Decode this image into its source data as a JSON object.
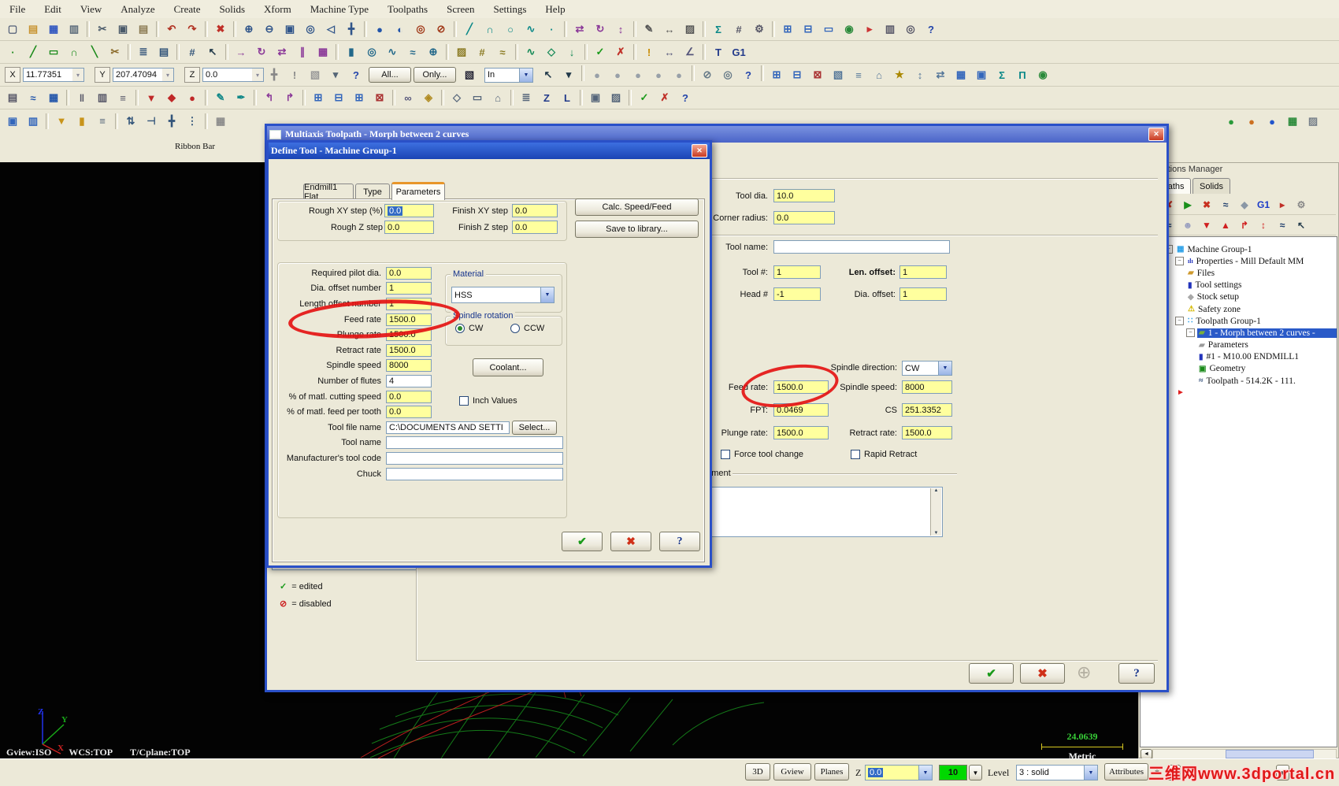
{
  "menu": {
    "items": [
      "File",
      "Edit",
      "View",
      "Analyze",
      "Create",
      "Solids",
      "Xform",
      "Machine Type",
      "Toolpaths",
      "Screen",
      "Settings",
      "Help"
    ]
  },
  "coord_bar": {
    "x": {
      "label": "X",
      "value": "11.77351"
    },
    "y": {
      "label": "Y",
      "value": "207.47094"
    },
    "z": {
      "label": "Z",
      "value": "0.0"
    },
    "all": "All...",
    "only": "Only...",
    "in": "In"
  },
  "ribbon_bar": "Ribbon Bar",
  "icons": {
    "ok": "✔",
    "cancel": "✖",
    "help": "?",
    "plus": "⊕",
    "close": "✕",
    "legend_check": "✓",
    "legend_disabled": "⊘",
    "up": "▲",
    "down": "▼",
    "left": "◄",
    "combo": "▼",
    "drop": "▾"
  },
  "toolbars": {
    "row1": [
      "new|▢|#55617a",
      "open|▤|#c89432",
      "save|▦|#2f55c0",
      "print|▥|#5a6a7a",
      "-",
      "cut|✂|#4a5a6a",
      "copy|▣|#4a5a6a",
      "paste|▤|#8a7a52",
      "-",
      "undo|↶|#b03020",
      "redo|↷|#b03020",
      "-",
      "delete|✖|#c03028",
      "-",
      "zoom-in|⊕|#30558a",
      "zoom-out|⊖|#30558a",
      "zoom-window|▣|#30558a",
      "zoom-fit|◎|#30558a",
      "zoom-previous|◁|#30558a",
      "pan|╋|#30558a",
      "-",
      "shade-sphere|●|#2255aa",
      "shade-half|◐|#2255aa",
      "wireframe-torus|◎|#a03818",
      "wireframe-off|⊘|#a03818",
      "-",
      "line|╱|#0a8888",
      "arc|∩|#0a8888",
      "circle|○|#0a8888",
      "spline|∿|#0a8888",
      "point|∙|#0a8888",
      "-",
      "mirror|⇄|#8a3898",
      "rotate|↻|#8a3898",
      "scale|↕|#8a3898",
      "-",
      "note|✎|#555555",
      "dimension|↔|#555555",
      "hatch|▨|#555555",
      "-",
      "sum|Σ|#0a8888",
      "grid|#|#555566",
      "gear|⚙|#555566",
      "-",
      "window-tile|⊞|#3366bb",
      "window-cascade|⊟|#3366bb",
      "screen|▭|#3366bb",
      "world|◉|#2a8a3a",
      "flag|▸|#cc3333",
      "film|▥|#555566",
      "camera|◎|#555566",
      "help|?|#2244aa"
    ],
    "row2": [
      "create-point|∙|#1a8a1a",
      "create-line|╱|#1a8a1a",
      "create-rect|▭|#1a8a1a",
      "create-fillet|∩|#1a8a1a",
      "create-chamfer|╲|#1a8a1a",
      "trim|✂|#8a6a2a",
      "-",
      "levels|≣|#33557a",
      "layers|▤|#33557a",
      "-",
      "snap|#|#33557a",
      "cursor|↖|#223a4a",
      "-",
      "xform-translate|→|#8a3898",
      "xform-rotate|↻|#8a3898",
      "xform-mirror|⇄|#8a3898",
      "xform-offset|∥|#8a3898",
      "xform-array|▦|#8a3898",
      "-",
      "extrude|▮|#22688a",
      "revolve|◎|#22688a",
      "sweep|∿|#22688a",
      "loft|≈|#22688a",
      "boolean|⊕|#22688a",
      "-",
      "surface|▨|#8a7a22",
      "net|#|#8a7a22",
      "blend|≈|#8a7a22",
      "-",
      "curve|∿|#118855",
      "isoparm|◇|#118855",
      "project|↓|#118855",
      "-",
      "ok-check|✓|#1a9a1a",
      "cancel-x|✗|#c03028",
      "-",
      "info|!|#c88a00",
      "measure|↔|#55557a",
      "angle|∠|#55557a",
      "-",
      "tool-letter|T|#223a8a",
      "post-g1|G1|#223a8a"
    ],
    "row3_pre": [
      "attach|╋|#888888",
      "alert|!|#888888",
      "fan|▧|#999999",
      "drop|▾|#556677",
      "help-round|?|#2244aa"
    ],
    "row3_post": [
      "pointer|↖|#223a4a",
      "pointer-drop|▾|#223a4a",
      "-",
      "chain-1|●|#98a0a8",
      "chain-2|●|#98a0a8",
      "chain-3|●|#98a0a8",
      "chain-4|●|#98a0a8",
      "chain-5|●|#98a0a8",
      "-",
      "none|⊘|#667a88",
      "target|◎|#667a88",
      "help-2|?|#2244aa",
      "-",
      "win-1|⊞|#3366bb",
      "win-2|⊟|#3366bb",
      "win-3|⊠|#aa3333",
      "panel|▧|#557799",
      "list|≡|#557799",
      "home|⌂|#557799",
      "star|★|#aa8800",
      "vflip|↕|#557799",
      "swap|⇄|#557799",
      "grid-2|▦|#3366bb",
      "box-2|▣|#3366bb",
      "sigma|Σ|#0a8888",
      "pi|Π|#0a8888",
      "globe|◉|#2a8a3a"
    ],
    "row4": [
      "levels-2|▤|#555566",
      "waves|≈|#2255aa",
      "grid-3|▦|#2255aa",
      "-",
      "bars|‖|#555566",
      "cells|▥|#555566",
      "rows|≡|#555566",
      "-",
      "red-down|▼|#c02828",
      "red-diamond|◆|#c02828",
      "red-dot|●|#c02828",
      "-",
      "pencil|✎|#118888",
      "pen|✒|#118888",
      "-",
      "turn-left|↰|#8a3898",
      "turn-right|↱|#8a3898",
      "-",
      "win-a|⊞|#3366bb",
      "win-b|⊟|#3366bb",
      "win-c|⊞|#3366bb",
      "win-d|⊠|#aa3333",
      "-",
      "chain|∞|#55557a",
      "lock|◈|#b08a20",
      "-",
      "gview-box|◇|#55657a",
      "plane-box|▭|#55657a",
      "wcs-home|⌂|#55657a",
      "-",
      "menu-lines|≣|#55657a",
      "letter-z|Z|#223a8a",
      "letter-l|L|#223a8a",
      "-",
      "attr-box|▣|#55657a",
      "color-box|▨|#55657a",
      "-",
      "check-2|✓|#1a9a1a",
      "x-2|✗|#c03028",
      "help-3|?|#2244aa"
    ],
    "row5_left": [
      "doc-a|▣|#3366bb",
      "doc-b|▥|#3366bb",
      "-",
      "funnel|▼|#c8941a",
      "marker|▮|#c8941a",
      "lines|≡|#55657a",
      "-",
      "updown|⇅|#33557a",
      "tee|⊣|#33557a",
      "cross|╋|#33557a",
      "dots|⋮|#33557a",
      "-",
      "grid-4|▦|#8a8a8a"
    ],
    "row5_right": [
      "ball-green|●|#2a9a3a",
      "ball-orange|●|#cc7020",
      "ball-blue|●|#2255cc",
      "box-green|▦|#2a8a3a",
      "box-grey|▨|#77808a"
    ],
    "ops_row1": [
      "regen-all|✔|#1a8f1a",
      "regen-invalid|✘|#c83020",
      "select-play|▶|#1a8f1a",
      "select-x|✖|#c83020",
      "backplot|≈|#1a3a6a",
      "verify|◆|#8a97a5",
      "post|G1|#1a3ac8",
      "feed-arrow|▸|#c03028",
      "helix|⚙|#888888"
    ],
    "ops_row2": [
      "lock-2|◈|#d8a020",
      "waves-2|≈|#1a3a6a",
      "ghost|☻|#9aa0c0",
      "move-down|▼|#d02020",
      "move-up|▲|#d02020",
      "insert|↱|#d02020",
      "expand|↕|#d02020",
      "scroll|≈|#1a3a6a",
      "pointer-2|↖|#223a4a"
    ]
  },
  "multiaxis": {
    "title": "Multiaxis Toolpath - Morph between 2 curves",
    "tool_dia": {
      "label": "Tool dia.",
      "value": "10.0"
    },
    "corner_radius": {
      "label": "Corner radius:",
      "value": "0.0"
    },
    "tool_name": {
      "label": "Tool name:",
      "value": ""
    },
    "tool_no": {
      "label": "Tool #:",
      "value": "1"
    },
    "len_offset": {
      "label": "Len. offset:",
      "value": "1"
    },
    "head_no": {
      "label": "Head #",
      "value": "-1"
    },
    "dia_offset": {
      "label": "Dia. offset:",
      "value": "1"
    },
    "spindle_direction": {
      "label": "Spindle direction:",
      "value": "CW"
    },
    "feed_rate": {
      "label": "Feed rate:",
      "value": "1500.0"
    },
    "spindle_speed": {
      "label": "Spindle speed:",
      "value": "8000"
    },
    "fpt": {
      "label": "FPT:",
      "value": "0.0469"
    },
    "cs": {
      "label": "CS",
      "value": "251.3352"
    },
    "plunge_rate": {
      "label": "Plunge rate:",
      "value": "1500.0"
    },
    "retract_rate": {
      "label": "Retract rate:",
      "value": "1500.0"
    },
    "force_tool_change": "Force tool change",
    "rapid_retract": "Rapid Retract",
    "comment_label": "Comment",
    "legend_edited": "= edited",
    "legend_disabled": "= disabled"
  },
  "define_tool": {
    "title": "Define Tool - Machine Group-1",
    "tabs": [
      "Endmill1 Flat",
      "Type",
      "Parameters"
    ],
    "top_fields": [
      {
        "label": "Rough XY step (%)",
        "value": "0.0"
      },
      {
        "label": "Rough Z step",
        "value": "0.0"
      },
      {
        "label": "Finish XY step",
        "value": "0.0"
      },
      {
        "label": "Finish Z step",
        "value": "0.0"
      }
    ],
    "buttons": {
      "calc": "Calc. Speed/Feed",
      "save": "Save to library...",
      "coolant": "Coolant..."
    },
    "param_rows": [
      {
        "label": "Required pilot dia.",
        "value": "0.0",
        "bg": "yellow"
      },
      {
        "label": "Dia. offset number",
        "value": "1",
        "bg": "yellow"
      },
      {
        "label": "Length offset number",
        "value": "1",
        "bg": "yellow"
      },
      {
        "label": "Feed rate",
        "value": "1500.0",
        "bg": "yellow"
      },
      {
        "label": "Plunge rate",
        "value": "1500.0",
        "bg": "yellow"
      },
      {
        "label": "Retract rate",
        "value": "1500.0",
        "bg": "yellow"
      },
      {
        "label": "Spindle speed",
        "value": "8000",
        "bg": "yellow"
      },
      {
        "label": "Number of flutes",
        "value": "4",
        "bg": "white"
      },
      {
        "label": "% of matl. cutting speed",
        "value": "0.0",
        "bg": "yellow"
      },
      {
        "label": "% of matl. feed per tooth",
        "value": "0.0",
        "bg": "yellow"
      },
      {
        "label": "Tool file name",
        "value": "C:\\DOCUMENTS AND SETTI",
        "bg": "white",
        "wide": true,
        "button": "Select..."
      },
      {
        "label": "Tool name",
        "value": "",
        "bg": "white",
        "wide": true
      },
      {
        "label": "Manufacturer's tool code",
        "value": "",
        "bg": "white",
        "wide": true
      },
      {
        "label": "Chuck",
        "value": "",
        "bg": "white",
        "wide": true
      }
    ],
    "material": {
      "group": "Material",
      "value": "HSS"
    },
    "spindle_rotation": {
      "group": "Spindle rotation",
      "cw": "CW",
      "ccw": "CCW"
    },
    "inch_values": "Inch Values"
  },
  "ops_manager": {
    "title": "Operations Manager",
    "tabs": [
      "Toolpaths",
      "Solids"
    ],
    "tree": [
      {
        "d": 0,
        "exp": true,
        "icon": "machine-group-icon",
        "g": "▦",
        "c": "#2ba0e8",
        "label": "Machine Group-1"
      },
      {
        "d": 1,
        "exp": true,
        "icon": "properties-icon",
        "g": "ılı",
        "c": "#2233bb",
        "label": "Properties - Mill Default MM"
      },
      {
        "d": 2,
        "icon": "files-folder-icon",
        "g": "▰",
        "c": "#cf9a2e",
        "label": "Files"
      },
      {
        "d": 2,
        "icon": "tool-settings-icon",
        "g": "▮",
        "c": "#2233bb",
        "label": "Tool settings"
      },
      {
        "d": 2,
        "icon": "stock-setup-icon",
        "g": "◆",
        "c": "#a8a8a8",
        "label": "Stock setup"
      },
      {
        "d": 2,
        "icon": "safety-zone-icon",
        "g": "⚠",
        "c": "#d4b800",
        "label": "Safety zone"
      },
      {
        "d": 1,
        "exp": true,
        "icon": "toolpath-group-icon",
        "g": "∷",
        "c": "#2ba0e8",
        "label": "Toolpath Group-1"
      },
      {
        "d": 2,
        "exp": true,
        "icon": "morph-folder-icon",
        "g": "▰",
        "c": "#7ab03a",
        "label": "1 - Morph between 2 curves -",
        "selected": true
      },
      {
        "d": 3,
        "icon": "parameters-folder-icon",
        "g": "▰",
        "c": "#9a9a9a",
        "label": "Parameters"
      },
      {
        "d": 3,
        "icon": "tool-icon",
        "g": "▮",
        "c": "#2233bb",
        "label": "#1 - M10.00 ENDMILL1"
      },
      {
        "d": 3,
        "icon": "geometry-icon",
        "g": "▣",
        "c": "#1a8a1a",
        "label": "Geometry"
      },
      {
        "d": 3,
        "icon": "toolpath-icon",
        "g": "≈",
        "c": "#1a3a6a",
        "label": "Toolpath - 514.2K - 111."
      },
      {
        "d": 1,
        "icon": "insert-arrow-icon",
        "g": "►",
        "c": "#e02020",
        "label": ""
      }
    ]
  },
  "status_bar": {
    "d3": "3D",
    "gview": "Gview",
    "planes": "Planes",
    "z_label": "Z",
    "z_value": "0.0",
    "level_num": "10",
    "level_label": "Level",
    "level_value": "3 : solid",
    "attributes": "Attributes",
    "star": "*"
  },
  "graphics": {
    "gview": "Gview:ISO",
    "wcs": "WCS:TOP",
    "tcplane": "T/Cplane:TOP",
    "scale_value": "24.0639",
    "scale_unit": "Metric",
    "axis": {
      "x": "X",
      "y": "Y",
      "z": "Z"
    }
  },
  "watermark": "三维网www.3dportal.cn"
}
